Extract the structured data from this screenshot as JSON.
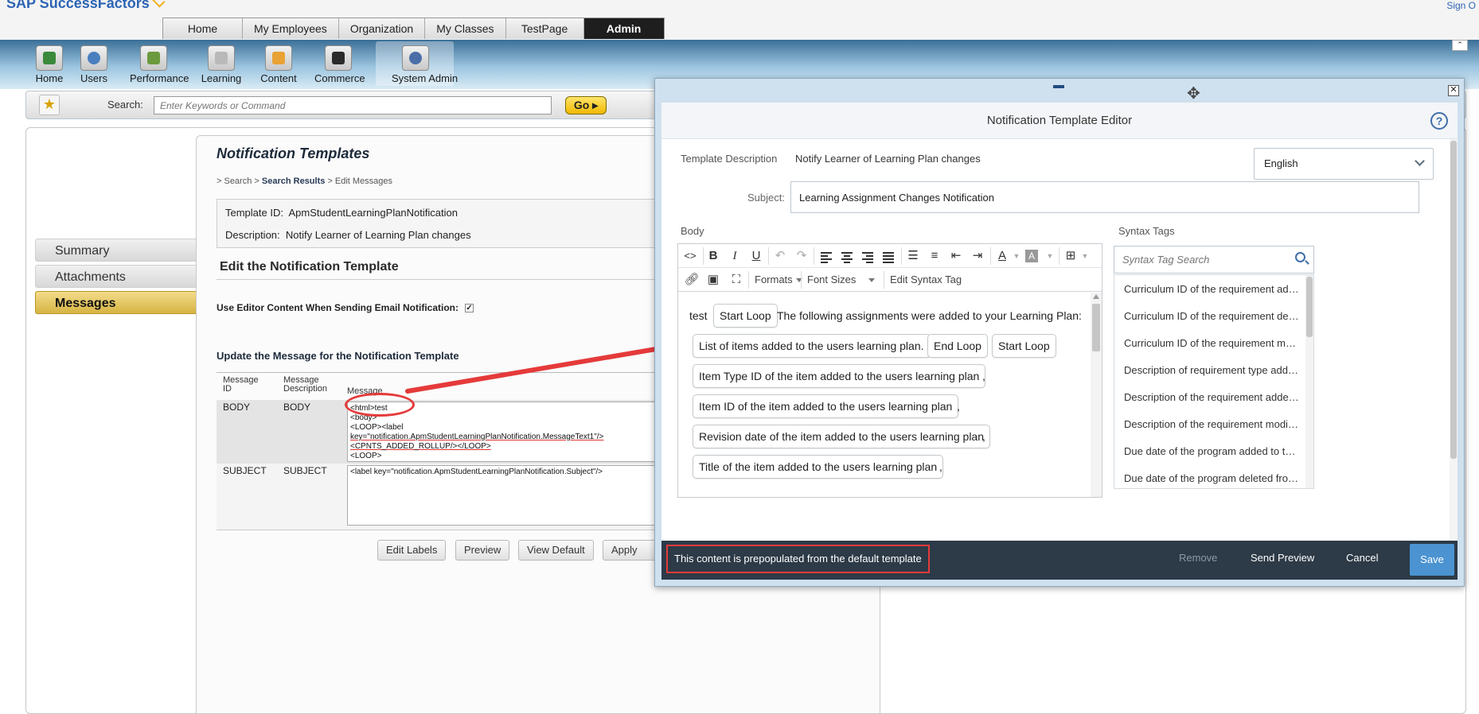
{
  "app": {
    "logo_text": "SAP SuccessFactors",
    "sign_in": "Sign O"
  },
  "main_tabs": [
    {
      "label": "Home"
    },
    {
      "label": "My Employees"
    },
    {
      "label": "Organization"
    },
    {
      "label": "My Classes"
    },
    {
      "label": "TestPage"
    },
    {
      "label": "Admin",
      "active": true
    }
  ],
  "app_icons": [
    {
      "label": "Home",
      "icon": "home-icon"
    },
    {
      "label": "Users",
      "icon": "users-icon"
    },
    {
      "label": "Performance",
      "icon": "performance-icon"
    },
    {
      "label": "Learning",
      "icon": "learning-icon"
    },
    {
      "label": "Content",
      "icon": "content-icon"
    },
    {
      "label": "Commerce",
      "icon": "commerce-icon"
    },
    {
      "label": "System Admin",
      "icon": "system-admin-icon"
    }
  ],
  "search": {
    "label": "Search:",
    "placeholder": "Enter Keywords or Command",
    "go_label": "Go"
  },
  "left_nav": [
    {
      "label": "Summary"
    },
    {
      "label": "Attachments"
    },
    {
      "label": "Messages",
      "active": true
    }
  ],
  "panel": {
    "title": "Notification Templates",
    "breadcrumb": {
      "prefix": "> Search > ",
      "link": "Search Results",
      "suffix": " > Edit Messages"
    },
    "template_id_label": "Template ID:",
    "template_id": "ApmStudentLearningPlanNotification",
    "description_label": "Description:",
    "description": "Notify Learner of Learning Plan changes",
    "edit_heading": "Edit the Notification Template",
    "use_editor_label": "Use Editor Content When Sending Email Notification:",
    "use_editor_checked": "✓",
    "update_heading": "Update the Message for the Notification Template",
    "table": {
      "headers": [
        "Message ID",
        "Message Description",
        "Message"
      ],
      "rows": [
        {
          "id": "BODY",
          "desc": "BODY",
          "lines": [
            "<html>test",
            "<body>",
            "<LOOP><label",
            "key=\"notification.ApmStudentLearningPlanNotification.MessageText1\"/>",
            "<CPNTS_ADDED_ROLLUP/></LOOP>",
            "<LOOP>"
          ]
        },
        {
          "id": "SUBJECT",
          "desc": "SUBJECT",
          "lines": [
            "<label key=\"notification.ApmStudentLearningPlanNotification.Subject\"/>"
          ]
        }
      ]
    },
    "buttons": [
      "Edit Labels",
      "Preview",
      "View Default",
      "Apply Ch"
    ]
  },
  "dialog": {
    "title": "Notification Template Editor",
    "template_description_label": "Template Description",
    "template_description": "Notify Learner of Learning Plan changes",
    "language": "English",
    "subject_label": "Subject:",
    "subject_value": "Learning Assignment Changes Notification",
    "body_label": "Body",
    "toolbar": {
      "formats": "Formats",
      "font_sizes": "Font Sizes",
      "edit_syntax_tag": "Edit Syntax Tag"
    },
    "body_content": {
      "test": "test",
      "start_loop_1": "Start Loop",
      "intro": "The following assignments were added to your Learning Plan:",
      "chip_list": "List of items added to the users learning plan.",
      "end_loop": "End Loop",
      "start_loop_2": "Start Loop",
      "chip_type": "Item Type ID of the item added to the users learning plan",
      "chip_id": "Item ID of the item added to the users learning plan",
      "chip_rev": "Revision date of the item added to the users learning plan",
      "chip_title": "Title of the item added to the users learning plan",
      "comma": ","
    },
    "syntax_tags_label": "Syntax Tags",
    "syntax_tag_search_placeholder": "Syntax Tag Search",
    "syntax_tags": [
      "Curriculum ID of the requirement added to the users learning plan",
      "Curriculum ID of the requirement deleted from the users learning plan",
      "Curriculum ID of the requirement modified in the users learning plan",
      "Description of requirement type added to the users learning plan",
      "Description of the requirement added to the users learning plan",
      "Description of the requirement modified in the users learning plan",
      "Due date of the program added to the users learning plan",
      "Due date of the program deleted from the users learning plan"
    ],
    "footer": {
      "notice": "This content is prepopulated from the default template",
      "remove": "Remove",
      "send_preview": "Send Preview",
      "cancel": "Cancel",
      "save": "Save"
    }
  },
  "colors": {
    "accent_blue": "#4b93d1",
    "footer_bg": "#2d3a47",
    "annotation_red": "#e53a3a",
    "admin_tab": "#1e1e1e",
    "active_nav_gold": "#d6b443"
  }
}
